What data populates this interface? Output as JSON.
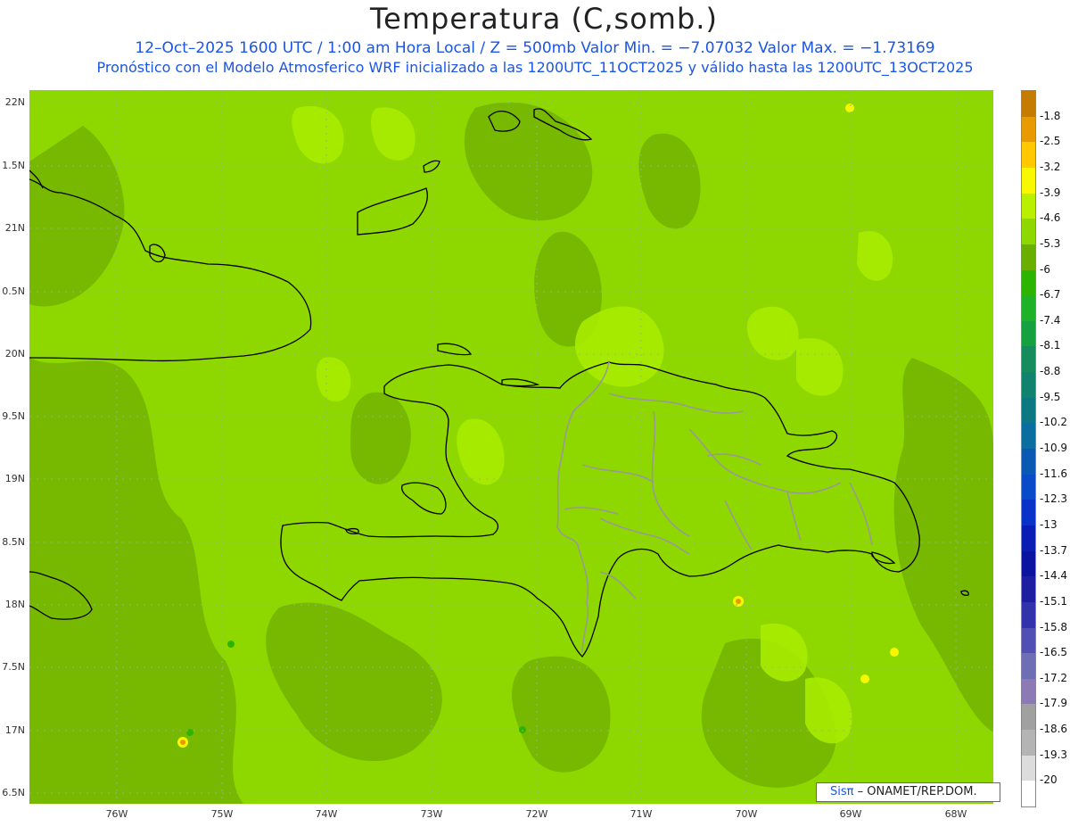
{
  "title": "Temperatura (C,somb.)",
  "subtitle1": "12–Oct–2025   1600 UTC / 1:00 am Hora Local / Z = 500mb   Valor Min. = −7.07032   Valor Max. = −1.73169",
  "subtitle2": "Pronóstico con el Modelo Atmosferico WRF inicializado a las 1200UTC_11OCT2025 y válido hasta las   1200UTC_13OCT2025",
  "y_labels": [
    "22N",
    "1.5N",
    "21N",
    "0.5N",
    "20N",
    "9.5N",
    "19N",
    "8.5N",
    "18N",
    "7.5N",
    "17N",
    "6.5N"
  ],
  "x_labels": [
    "76W",
    "75W",
    "74W",
    "73W",
    "72W",
    "71W",
    "70W",
    "69W",
    "68W"
  ],
  "colorbar": {
    "labels": [
      "-1.8",
      "-2.5",
      "-3.2",
      "-3.9",
      "-4.6",
      "-5.3",
      "-6",
      "-6.7",
      "-7.4",
      "-8.1",
      "-8.8",
      "-9.5",
      "-10.2",
      "-10.9",
      "-11.6",
      "-12.3",
      "-13",
      "-13.7",
      "-14.4",
      "-15.1",
      "-15.8",
      "-16.5",
      "-17.2",
      "-17.9",
      "-18.6",
      "-19.3",
      "-20"
    ],
    "colors": [
      "#c57a00",
      "#e89a00",
      "#ffc800",
      "#f7f700",
      "#b8f000",
      "#8ed800",
      "#6aae00",
      "#2db400",
      "#1fb228",
      "#16a040",
      "#168c5c",
      "#10826e",
      "#0c7882",
      "#0a6ea0",
      "#0a5ab4",
      "#0a4cc8",
      "#0a32c8",
      "#0a1eb4",
      "#0a14a0",
      "#1e1ea0",
      "#3232aa",
      "#5050b4",
      "#6e6eb4",
      "#8c7ab4",
      "#a0a0a0",
      "#b4b4b4",
      "#dcdcdc",
      "#ffffff"
    ]
  },
  "credit": {
    "brand": "Sisπ",
    "text": " – ONAMET/REP.DOM."
  }
}
